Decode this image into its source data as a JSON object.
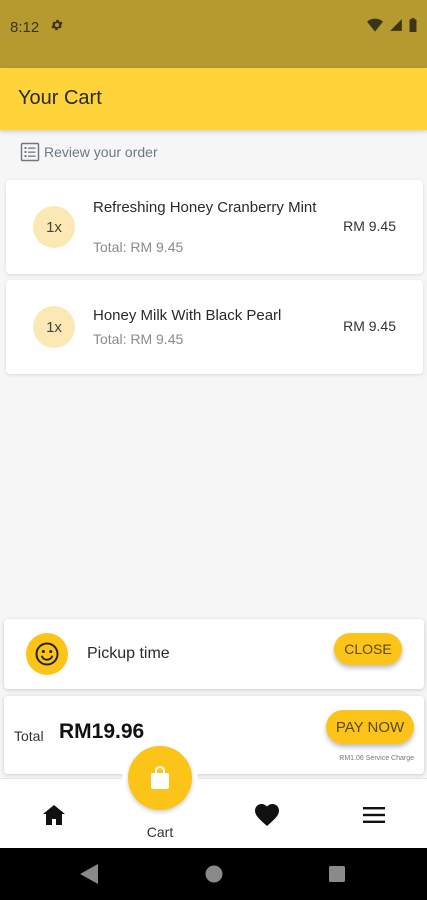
{
  "status_bar": {
    "time": "8:12",
    "settings_icon": "gear-icon",
    "icons": [
      "wifi-icon",
      "signal-icon",
      "battery-icon"
    ]
  },
  "app_bar": {
    "title": "Your Cart"
  },
  "review": {
    "label": "Review your order",
    "icon": "list-icon"
  },
  "cart_items": [
    {
      "qty": "1x",
      "name": "Refreshing Honey Cranberry Mint",
      "total": "Total: RM 9.45",
      "price": "RM 9.45"
    },
    {
      "qty": "1x",
      "name": "Honey Milk With Black Pearl",
      "total": "Total: RM 9.45",
      "price": "RM 9.45"
    }
  ],
  "pickup": {
    "label": "Pickup time",
    "button": "CLOSE",
    "icon": "smiley-icon"
  },
  "totals": {
    "label": "Total",
    "amount": "RM19.96",
    "pay_button": "PAY NOW",
    "service_charge": "RM1.06 Service Charge"
  },
  "bottom_nav": {
    "items": [
      "home-icon",
      "cart-icon",
      "heart-icon",
      "menu-icon"
    ],
    "cart_label": "Cart"
  },
  "colors": {
    "accent": "#fcc419",
    "app_bar": "#ffd43b",
    "status_bar": "#b59a2f",
    "badge": "#fce8b5"
  },
  "system_nav": [
    "back-icon",
    "home-circle-icon",
    "recents-icon"
  ]
}
